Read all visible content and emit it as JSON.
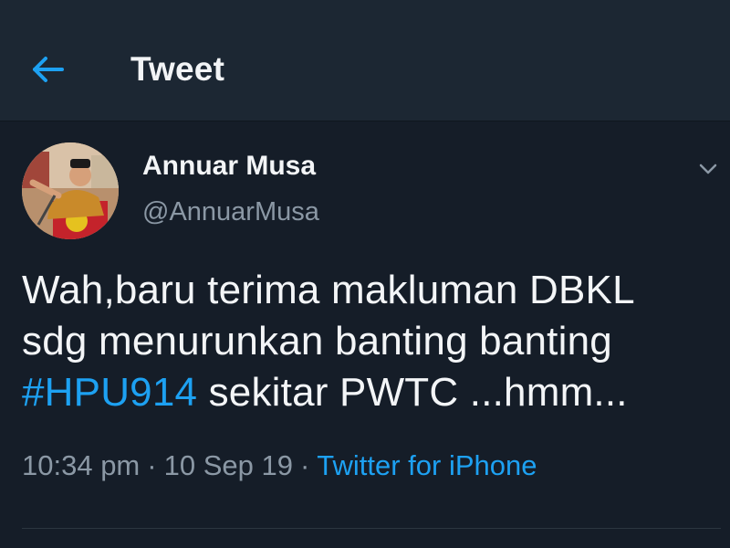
{
  "header": {
    "title": "Tweet",
    "back_icon": "arrow-left-icon"
  },
  "tweet": {
    "author_name": "Annuar Musa",
    "author_handle": "@AnnuarMusa",
    "text_line_1": "Wah,baru terima makluman DBKL",
    "text_line_2": "sdg menurunkan banting banting",
    "hashtag": "#HPU914",
    "text_line_3_rest": " sekitar PWTC ...hmm...",
    "time": "10:34 pm",
    "date": "10 Sep 19",
    "separator": "·",
    "source": "Twitter for iPhone",
    "menu_icon": "chevron-down-icon"
  },
  "colors": {
    "background": "#151d28",
    "header_background": "#1c2733",
    "accent": "#1da1f2",
    "secondary_text": "#8b98a5",
    "primary_text": "#f3f5f7"
  }
}
